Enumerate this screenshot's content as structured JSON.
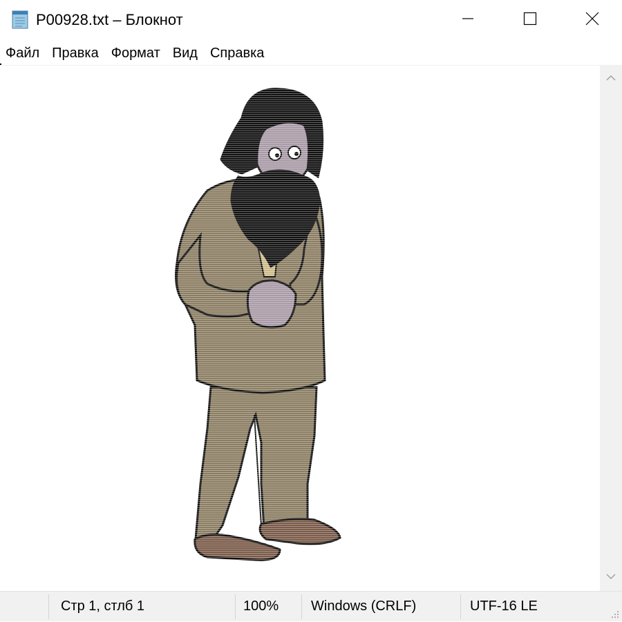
{
  "window": {
    "title": "P00928.txt – Блокнот",
    "icon": "notepad-icon",
    "controls": [
      "minimize-icon",
      "maximize-icon",
      "close-icon"
    ]
  },
  "menu": {
    "items": [
      "Файл",
      "Правка",
      "Формат",
      "Вид",
      "Справка"
    ]
  },
  "editor": {
    "content": "ASCII-art picture of a bearded man in a brown suit",
    "scrollbar": {
      "up": "chevron-up-icon",
      "down": "chevron-down-icon"
    }
  },
  "status": {
    "position": "Стр 1, стлб 1",
    "zoom": "100%",
    "line_endings": "Windows (CRLF)",
    "encoding": "UTF-16 LE"
  },
  "colors": {
    "suit": "#8b7d62",
    "beard": "#111111",
    "skin": "#a89aa6",
    "shoes": "#7a5a48",
    "chrome_bg": "#f1f1f1"
  }
}
